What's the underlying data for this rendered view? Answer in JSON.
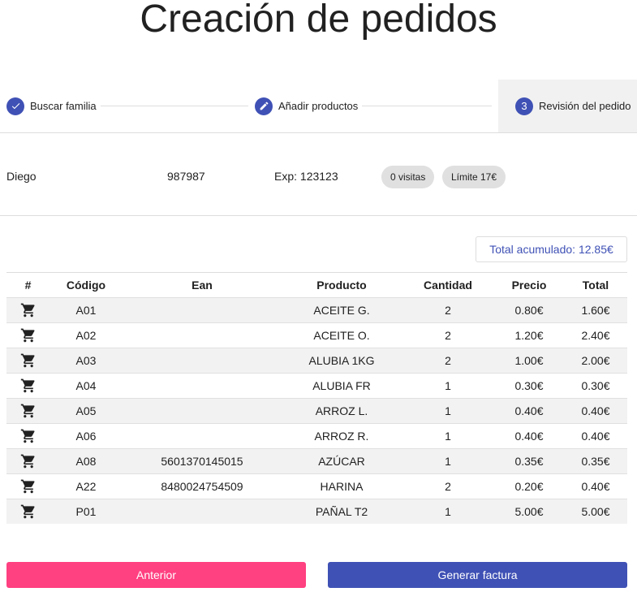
{
  "page_title": "Creación de pedidos",
  "stepper": {
    "steps": [
      {
        "label": "Buscar familia",
        "state": "done",
        "icon": "check-icon"
      },
      {
        "label": "Añadir productos",
        "state": "edit",
        "icon": "pencil-icon"
      },
      {
        "label": "Revisión del pedido",
        "state": "active",
        "number": "3"
      }
    ]
  },
  "customer": {
    "name": "Diego",
    "id": "987987",
    "exp": "Exp: 123123",
    "visits_badge": "0 visitas",
    "limit_badge": "Límite 17€"
  },
  "total_label": "Total acumulado: 12.85€",
  "table": {
    "headers": [
      "#",
      "Código",
      "Ean",
      "Producto",
      "Cantidad",
      "Precio",
      "Total"
    ],
    "rows": [
      {
        "code": "A01",
        "ean": "",
        "product": "ACEITE G.",
        "qty": "2",
        "price": "0.80€",
        "total": "1.60€"
      },
      {
        "code": "A02",
        "ean": "",
        "product": "ACEITE O.",
        "qty": "2",
        "price": "1.20€",
        "total": "2.40€"
      },
      {
        "code": "A03",
        "ean": "",
        "product": "ALUBIA 1KG",
        "qty": "2",
        "price": "1.00€",
        "total": "2.00€"
      },
      {
        "code": "A04",
        "ean": "",
        "product": "ALUBIA FR",
        "qty": "1",
        "price": "0.30€",
        "total": "0.30€"
      },
      {
        "code": "A05",
        "ean": "",
        "product": "ARROZ L.",
        "qty": "1",
        "price": "0.40€",
        "total": "0.40€"
      },
      {
        "code": "A06",
        "ean": "",
        "product": "ARROZ R.",
        "qty": "1",
        "price": "0.40€",
        "total": "0.40€"
      },
      {
        "code": "A08",
        "ean": "5601370145015",
        "product": "AZÚCAR",
        "qty": "1",
        "price": "0.35€",
        "total": "0.35€"
      },
      {
        "code": "A22",
        "ean": "8480024754509",
        "product": "HARINA",
        "qty": "2",
        "price": "0.20€",
        "total": "0.40€"
      },
      {
        "code": "P01",
        "ean": "",
        "product": "PAÑAL T2",
        "qty": "1",
        "price": "5.00€",
        "total": "5.00€"
      }
    ]
  },
  "buttons": {
    "prev": "Anterior",
    "next": "Generar factura"
  },
  "colors": {
    "primary": "#3f51b5",
    "accent": "#ff4081"
  }
}
